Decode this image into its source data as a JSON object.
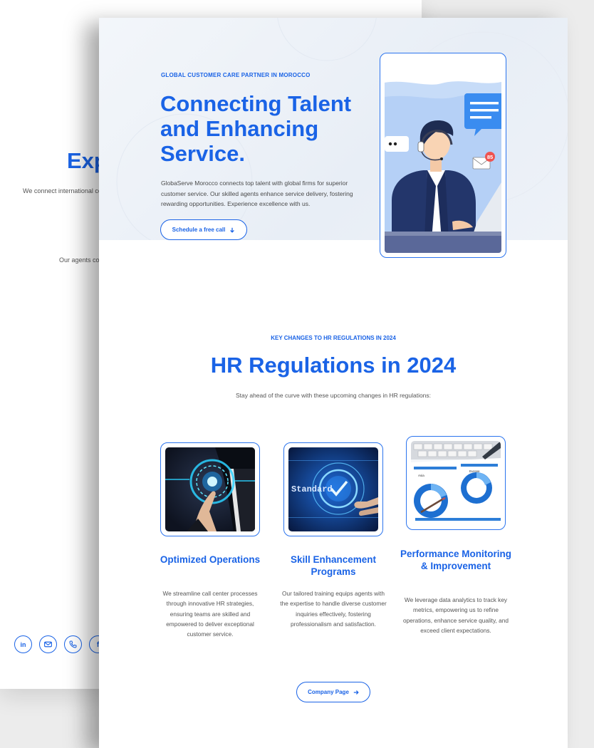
{
  "back_page": {
    "title": "Exp",
    "subtitle": "We connect international co",
    "subtitle2": "Our agents co",
    "social": [
      "linkedin-icon",
      "mail-icon",
      "phone-icon",
      "facebook-icon"
    ]
  },
  "hero": {
    "eyebrow": "GLOBAL CUSTOMER CARE PARTNER IN MOROCCO",
    "title": "Connecting Talent and Enhancing Service.",
    "description": "GlobaServe Morocco connects top talent with global firms for superior customer service. Our skilled agents enhance service delivery, fostering rewarding opportunities. Experience excellence with us.",
    "cta_label": "Schedule a free call",
    "notification_count": "85"
  },
  "section": {
    "eyebrow": "KEY CHANGES TO HR REGULATIONS IN 2024",
    "title": "HR Regulations in 2024",
    "subtitle": "Stay ahead of the curve with these upcoming changes in HR regulations:"
  },
  "cards": [
    {
      "title": "Optimized Operations",
      "text": "We streamline call center processes through innovative HR strategies, ensuring teams are skilled and empowered to deliver exceptional customer service."
    },
    {
      "title": "Skill Enhancement Programs",
      "text": "Our tailored training equips agents with the expertise to handle diverse customer inquiries effectively, fostering professionalism and satisfaction.",
      "image_label": "Standard"
    },
    {
      "title": "Performance Monitoring & Improvement",
      "text": "We leverage data analytics to track key metrics, empowering us to refine operations, enhance service quality, and exceed client expectations.",
      "image_labels": [
        "Europe",
        "Asia"
      ]
    }
  ],
  "footer_cta": {
    "label": "Company Page"
  },
  "colors": {
    "accent": "#1a63e6",
    "text": "#555555",
    "hero_bg": "#eef2f8"
  }
}
